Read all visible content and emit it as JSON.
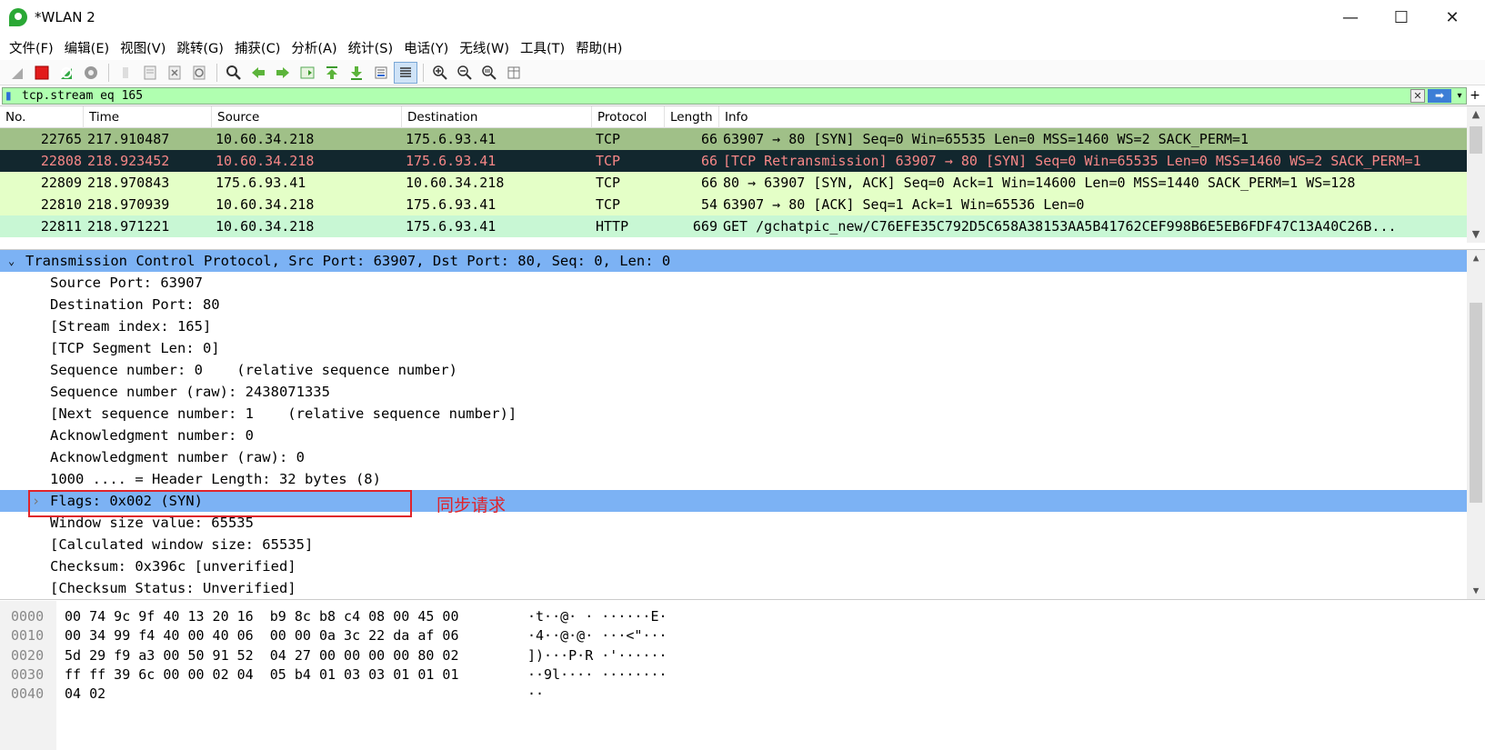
{
  "window": {
    "title": "*WLAN 2",
    "minimize": "—",
    "maximize": "☐",
    "close": "✕"
  },
  "menu": [
    {
      "label": "文件(F)"
    },
    {
      "label": "编辑(E)"
    },
    {
      "label": "视图(V)"
    },
    {
      "label": "跳转(G)"
    },
    {
      "label": "捕获(C)"
    },
    {
      "label": "分析(A)"
    },
    {
      "label": "统计(S)"
    },
    {
      "label": "电话(Y)"
    },
    {
      "label": "无线(W)"
    },
    {
      "label": "工具(T)"
    },
    {
      "label": "帮助(H)"
    }
  ],
  "filter": {
    "value": "tcp.stream eq 165"
  },
  "packet_list": {
    "columns": [
      "No.",
      "Time",
      "Source",
      "Destination",
      "Protocol",
      "Length",
      "Info"
    ],
    "rows": [
      {
        "no": "22765",
        "time": "217.910487",
        "src": "10.60.34.218",
        "dst": "175.6.93.41",
        "proto": "TCP",
        "len": "66",
        "info": "63907 → 80 [SYN] Seq=0 Win=65535 Len=0 MSS=1460 WS=2 SACK_PERM=1",
        "bg": "#a0c088",
        "fg": "#000000"
      },
      {
        "no": "22808",
        "time": "218.923452",
        "src": "10.60.34.218",
        "dst": "175.6.93.41",
        "proto": "TCP",
        "len": "66",
        "info": "[TCP Retransmission] 63907 → 80 [SYN] Seq=0 Win=65535 Len=0 MSS=1460 WS=2 SACK_PERM=1",
        "bg": "#12272e",
        "fg": "#f78787"
      },
      {
        "no": "22809",
        "time": "218.970843",
        "src": "175.6.93.41",
        "dst": "10.60.34.218",
        "proto": "TCP",
        "len": "66",
        "info": "80 → 63907 [SYN, ACK] Seq=0 Ack=1 Win=14600 Len=0 MSS=1440 SACK_PERM=1 WS=128",
        "bg": "#e4ffc7",
        "fg": "#000000"
      },
      {
        "no": "22810",
        "time": "218.970939",
        "src": "10.60.34.218",
        "dst": "175.6.93.41",
        "proto": "TCP",
        "len": "54",
        "info": "63907 → 80 [ACK] Seq=1 Ack=1 Win=65536 Len=0",
        "bg": "#e4ffc7",
        "fg": "#000000"
      },
      {
        "no": "22811",
        "time": "218.971221",
        "src": "10.60.34.218",
        "dst": "175.6.93.41",
        "proto": "HTTP",
        "len": "669",
        "info": "GET /gchatpic_new/C76EFE35C792D5C658A38153AA5B41762CEF998B6E5EB6FDF47C13A40C26B...",
        "bg": "#c8f7d4",
        "fg": "#000000"
      }
    ]
  },
  "detail": {
    "header": "Transmission Control Protocol, Src Port: 63907, Dst Port: 80, Seq: 0, Len: 0",
    "lines": [
      "Source Port: 63907",
      "Destination Port: 80",
      "[Stream index: 165]",
      "[TCP Segment Len: 0]",
      "Sequence number: 0    (relative sequence number)",
      "Sequence number (raw): 2438071335",
      "[Next sequence number: 1    (relative sequence number)]",
      "Acknowledgment number: 0",
      "Acknowledgment number (raw): 0",
      "1000 .... = Header Length: 32 bytes (8)",
      "Flags: 0x002 (SYN)",
      "Window size value: 65535",
      "[Calculated window size: 65535]",
      "Checksum: 0x396c [unverified]",
      "[Checksum Status: Unverified]"
    ],
    "selected_line": "Flags: 0x002 (SYN)",
    "annotation": "同步请求"
  },
  "hex": {
    "offsets": [
      "0000",
      "0010",
      "0020",
      "0030",
      "0040"
    ],
    "bytes": [
      "00 74 9c 9f 40 13 20 16  b9 8c b8 c4 08 00 45 00",
      "00 34 99 f4 40 00 40 06  00 00 0a 3c 22 da af 06",
      "5d 29 f9 a3 00 50 91 52  04 27 00 00 00 00 80 02",
      "ff ff 39 6c 00 00 02 04  05 b4 01 03 03 01 01 01",
      "04 02"
    ],
    "ascii": [
      "·t··@· · ······E·",
      "·4··@·@· ···<\"···",
      "])···P·R ·'······",
      "··9l···· ········",
      "··"
    ]
  },
  "colors": {
    "accent_selection": "#7cb2f4",
    "annotation_red": "#e0242b",
    "filter_valid": "#b0ffb0"
  }
}
